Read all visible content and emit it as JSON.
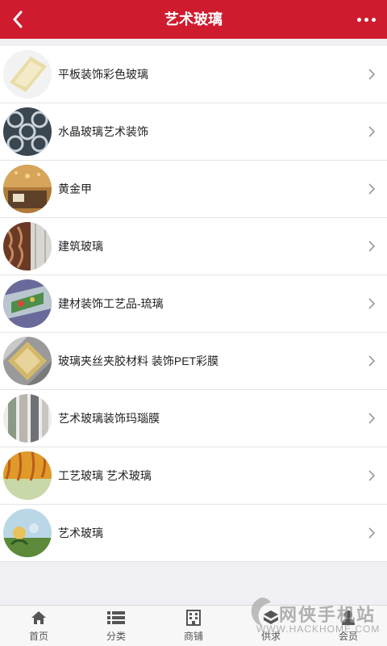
{
  "header": {
    "title": "艺术玻璃",
    "back_icon": "chevron-left-icon",
    "more_icon": "more-dots-icon"
  },
  "items": [
    {
      "label": "平板装饰彩色玻璃",
      "thumb": "thumb-1"
    },
    {
      "label": "水晶玻璃艺术装饰",
      "thumb": "thumb-2"
    },
    {
      "label": "黄金甲",
      "thumb": "thumb-3"
    },
    {
      "label": "建筑玻璃",
      "thumb": "thumb-4"
    },
    {
      "label": "建材装饰工艺品-琉璃",
      "thumb": "thumb-5"
    },
    {
      "label": "玻璃夹丝夹胶材料 装饰PET彩膜",
      "thumb": "thumb-6"
    },
    {
      "label": "艺术玻璃装饰玛瑙膜",
      "thumb": "thumb-7"
    },
    {
      "label": "工艺玻璃 艺术玻璃",
      "thumb": "thumb-8"
    },
    {
      "label": "艺术玻璃",
      "thumb": "thumb-9"
    }
  ],
  "tabbar": {
    "tabs": [
      {
        "label": "首页",
        "icon": "home-icon"
      },
      {
        "label": "分类",
        "icon": "list-icon"
      },
      {
        "label": "商铺",
        "icon": "building-icon"
      },
      {
        "label": "供求",
        "icon": "supply-icon"
      },
      {
        "label": "会员",
        "icon": "user-icon"
      }
    ]
  },
  "watermark": {
    "text": "网侠手机站",
    "url": "WWW.HACKHOME.COM"
  },
  "colors": {
    "header": "#cf1b2e",
    "background": "#efeff4"
  }
}
